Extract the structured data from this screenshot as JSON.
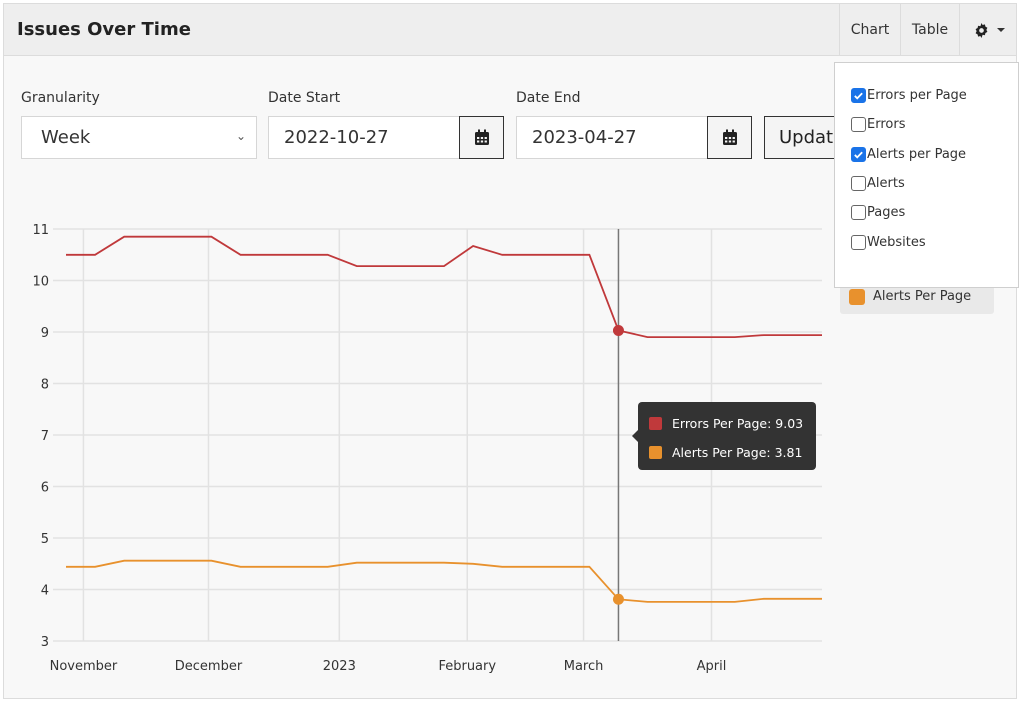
{
  "card": {
    "title": "Issues Over Time",
    "view_buttons": {
      "chart": "Chart",
      "table": "Table",
      "settings_icon": "gear-icon"
    }
  },
  "filters": {
    "granularity_label": "Granularity",
    "granularity_value": "Week",
    "date_start_label": "Date Start",
    "date_start_value": "2022-10-27",
    "date_end_label": "Date End",
    "date_end_value": "2023-04-27",
    "update_label": "Update"
  },
  "series_menu": {
    "items": [
      {
        "label": "Errors per Page",
        "checked": true
      },
      {
        "label": "Errors",
        "checked": false
      },
      {
        "label": "Alerts per Page",
        "checked": true
      },
      {
        "label": "Alerts",
        "checked": false
      },
      {
        "label": "Pages",
        "checked": false
      },
      {
        "label": "Websites",
        "checked": false
      }
    ]
  },
  "tooltip": {
    "rows": [
      {
        "text": "Errors Per Page: 9.03",
        "color": "#c0393b"
      },
      {
        "text": "Alerts Per Page: 3.81",
        "color": "#e8912d"
      }
    ]
  },
  "chart_data": {
    "type": "line",
    "title": "",
    "xlabel": "",
    "ylabel": "",
    "ylim": [
      3,
      11
    ],
    "yticks": [
      3,
      4,
      5,
      6,
      7,
      8,
      9,
      10,
      11
    ],
    "x_unit": "week index from 2022-10-27 to 2023-04-27",
    "x_tick_labels": [
      {
        "label": "November",
        "week": 0.6
      },
      {
        "label": "December",
        "week": 4.9
      },
      {
        "label": "2023",
        "week": 9.4
      },
      {
        "label": "February",
        "week": 13.8
      },
      {
        "label": "March",
        "week": 17.8
      },
      {
        "label": "April",
        "week": 22.2
      }
    ],
    "grid": true,
    "legend": [
      {
        "name": "Alerts Per Page",
        "color": "#e8912d",
        "position": "right"
      }
    ],
    "hover_index": 19,
    "series": [
      {
        "name": "Errors Per Page",
        "color": "#c0393b",
        "values": [
          10.5,
          10.5,
          10.85,
          10.85,
          10.85,
          10.85,
          10.5,
          10.5,
          10.5,
          10.5,
          10.28,
          10.28,
          10.28,
          10.28,
          10.67,
          10.5,
          10.5,
          10.5,
          10.5,
          9.03,
          8.9,
          8.9,
          8.9,
          8.9,
          8.94,
          8.94,
          8.94
        ]
      },
      {
        "name": "Alerts Per Page",
        "color": "#e8912d",
        "values": [
          4.44,
          4.44,
          4.56,
          4.56,
          4.56,
          4.56,
          4.44,
          4.44,
          4.44,
          4.44,
          4.52,
          4.52,
          4.52,
          4.52,
          4.5,
          4.44,
          4.44,
          4.44,
          4.44,
          3.81,
          3.76,
          3.76,
          3.76,
          3.76,
          3.82,
          3.82,
          3.82
        ]
      }
    ]
  }
}
